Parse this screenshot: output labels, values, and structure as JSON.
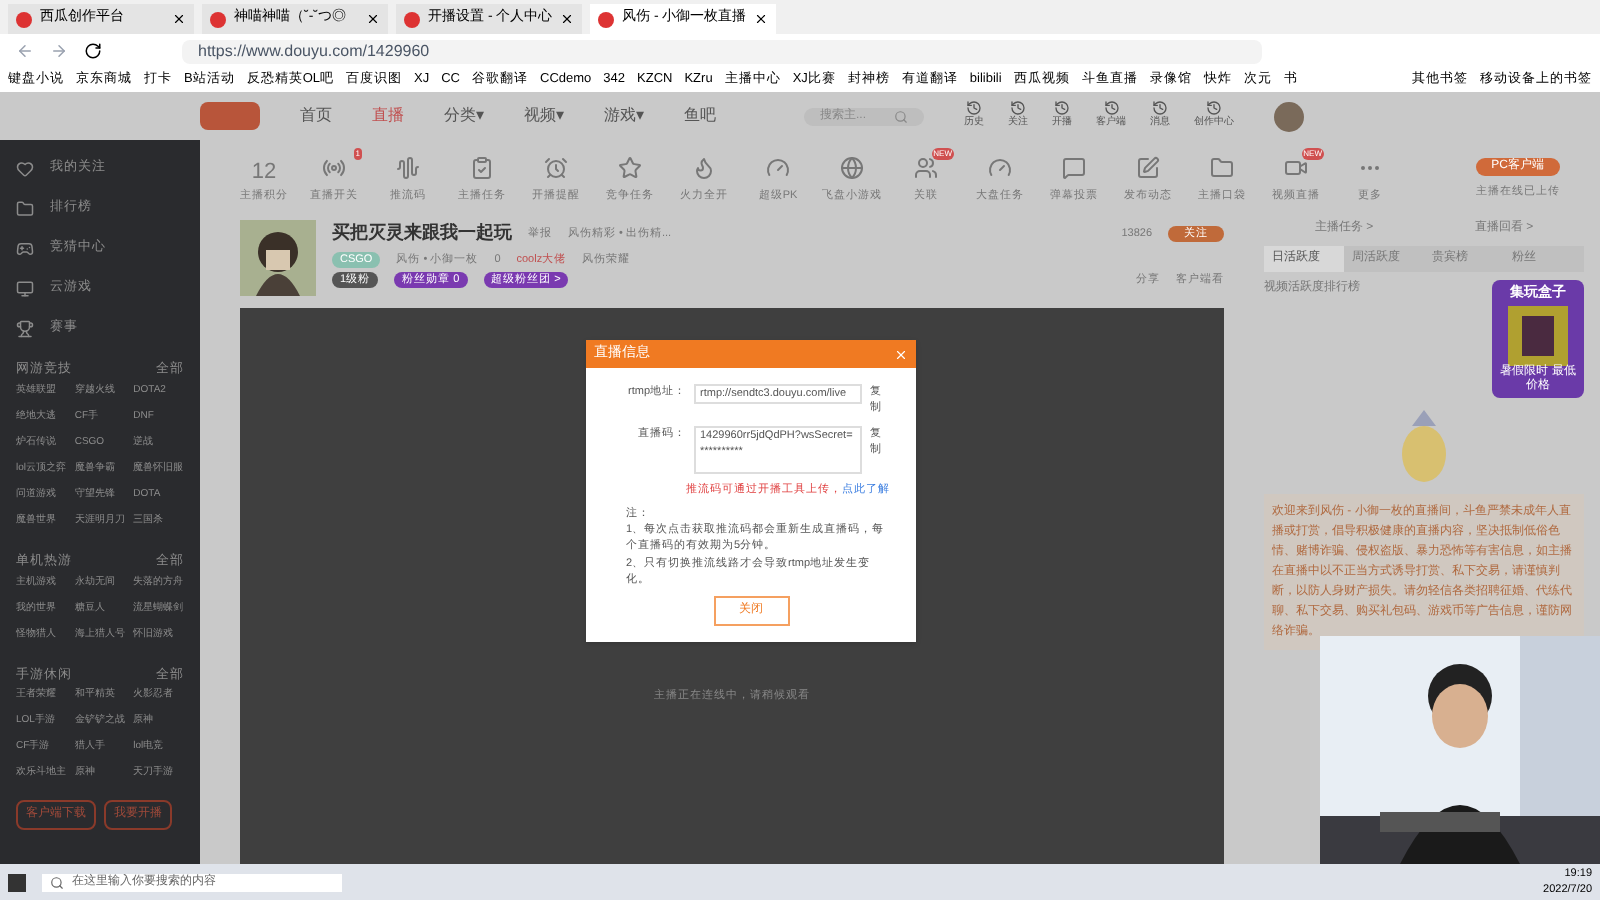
{
  "browser": {
    "tabs": [
      {
        "title": "西瓜创作平台",
        "selected": false
      },
      {
        "title": "神喵神喵（˘-˘つ◎",
        "selected": false
      },
      {
        "title": "开播设置 - 个人中心",
        "selected": false
      },
      {
        "title": "风伤 - 小御一枚直播",
        "selected": true
      }
    ],
    "url": "https://www.douyu.com/1429960",
    "bookmarks": [
      "键盘小说",
      "京东商城",
      "打卡",
      "B站活动",
      "反恐精英OL吧",
      "百度识图",
      "XJ",
      "CC",
      "谷歌翻译",
      "CCdemo",
      "342",
      "KZCN",
      "KZru",
      "主播中心",
      "XJ比赛",
      "封神榜",
      "有道翻译",
      "bilibili",
      "西瓜视频",
      "斗鱼直播",
      "录像馆",
      "快炸",
      "次元",
      "书"
    ],
    "bookmarks_right": [
      "其他书签",
      "移动设备上的书签"
    ]
  },
  "header": {
    "nav": [
      {
        "label": "首页",
        "selected": false
      },
      {
        "label": "直播",
        "selected": true
      },
      {
        "label": "分类▾",
        "selected": false
      },
      {
        "label": "视频▾",
        "selected": false
      },
      {
        "label": "游戏▾",
        "selected": false
      },
      {
        "label": "鱼吧",
        "selected": false
      }
    ],
    "search": {
      "placeholder": "搜索主..."
    },
    "icons": [
      "历史",
      "关注",
      "开播",
      "客户端",
      "消息",
      "创作中心"
    ]
  },
  "sidebar": {
    "links": [
      "我的关注",
      "排行榜",
      "竞猜中心",
      "云游戏",
      "赛事"
    ],
    "sections": [
      {
        "title": "网游竞技",
        "more": "全部",
        "items": [
          "英雄联盟",
          "穿越火线",
          "DOTA2",
          "绝地大逃",
          "CF手",
          "DNF",
          "炉石传说",
          "CSGO",
          "逆战",
          "lol云顶之弈",
          "魔兽争霸",
          "魔兽怀旧服",
          "问道游戏",
          "守望先锋",
          "DOTA",
          "魔兽世界",
          "天涯明月刀",
          "三国杀"
        ]
      },
      {
        "title": "单机热游",
        "more": "全部",
        "items": [
          "主机游戏",
          "永劫无间",
          "失落的方舟",
          "我的世界",
          "糖豆人",
          "流星蝴蝶剑",
          "怪物猎人",
          "海上猎人号",
          "怀旧游戏"
        ]
      },
      {
        "title": "手游休闲",
        "more": "全部",
        "items": [
          "王者荣耀",
          "和平精英",
          "火影忍者",
          "LOL手游",
          "金铲铲之战",
          "原神",
          "CF手游",
          "猎人手",
          "lol电竞",
          "欢乐斗地主",
          "原神",
          "天刀手游"
        ]
      }
    ],
    "buttons": [
      "客户端下载",
      "我要开播"
    ]
  },
  "toolbar": {
    "score": "12",
    "score_label": "主播积分",
    "tools": [
      {
        "label": "直播开关",
        "badge": "1"
      },
      {
        "label": "推流码"
      },
      {
        "label": "主播任务"
      },
      {
        "label": "开播提醒"
      },
      {
        "label": "竞争任务"
      },
      {
        "label": "火力全开"
      },
      {
        "label": "超级PK"
      },
      {
        "label": "飞盘小游戏"
      },
      {
        "label": "关联",
        "badge": "NEW"
      },
      {
        "label": "大盘任务"
      },
      {
        "label": "弹幕投票"
      },
      {
        "label": "发布动态"
      },
      {
        "label": "主播口袋"
      },
      {
        "label": "视频直播",
        "badge": "NEW"
      },
      {
        "label": "更多"
      }
    ],
    "client_button": "PC客户端",
    "client_note": "主播在线已上传"
  },
  "room": {
    "title": "买把灭灵来跟我一起玩",
    "report": "举报",
    "subtitle": "风伤精彩 • 出伤精...",
    "tag": "CSGO",
    "streamer": "风伤 • 小御一枚",
    "heat": "0",
    "medal": "coolz大佬",
    "team": "风伤荣耀",
    "level": "1级粉",
    "fans": "粉丝勋章 0",
    "fan_club": "超级粉丝团 >",
    "followers": "13826",
    "follow": "关注",
    "share": "分享",
    "client": "客户端看"
  },
  "video": {
    "status": "主播正在连线中，请稍候观看"
  },
  "dialog": {
    "title": "直播信息",
    "fields": [
      {
        "label": "rtmp地址：",
        "value": "rtmp://sendtc3.douyu.com/live",
        "copy": "复制"
      },
      {
        "label": "直播码：",
        "value": "1429960rr5jdQdPH?wsSecret=**********",
        "copy": "复制"
      }
    ],
    "warning": "推流码可通过开播工具上传，",
    "link": "点此了解",
    "note_title": "注：",
    "notes": [
      "1、每次点击获取推流码都会重新生成直播码，每个直播码的有效期为5分钟。",
      "2、只有切换推流线路才会导致rtmp地址发生变化。"
    ],
    "close": "关闭"
  },
  "right_panel": {
    "links": [
      "主播任务 >",
      "直播回看 >"
    ],
    "tabs": [
      {
        "label": "日活跃度",
        "selected": true
      },
      {
        "label": "周活跃度",
        "selected": false
      },
      {
        "label": "贵宾榜",
        "selected": false
      },
      {
        "label": "粉丝",
        "selected": false
      }
    ],
    "rank_title": "视频活跃度排行榜",
    "ad": {
      "title": "集玩盒子",
      "caption": "暑假限时 最低价格"
    },
    "notice": "欢迎来到风伤 - 小御一枚的直播间，斗鱼严禁未成年人直播或打赏，倡导积极健康的直播内容，坚决抵制低俗色情、赌博诈骗、侵权盗版、暴力恐怖等有害信息，如主播在直播中以不正当方式诱导打赏、私下交易，请谨慎判断，以防人身财产损失。请勿轻信各类招聘征婚、代练代聊、私下交易、购买礼包码、游戏币等广告信息，谨防网络诈骗。"
  },
  "taskbar": {
    "search": {
      "placeholder": "在这里输入你要搜索的内容"
    },
    "time": "19:19",
    "date": "2022/7/20"
  }
}
